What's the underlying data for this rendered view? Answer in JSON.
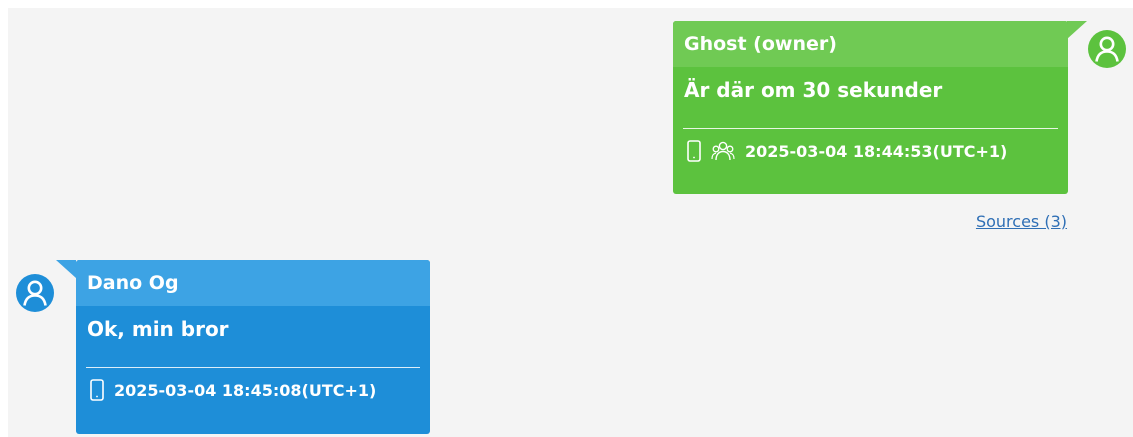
{
  "colors": {
    "background": "#f4f4f4",
    "green_bubble": "#5cc23e",
    "green_header": "#70ca54",
    "blue_bubble": "#1e8ed8",
    "blue_header": "#3da3e4",
    "link": "#2f6fb5"
  },
  "messages": [
    {
      "direction": "outgoing",
      "sender": "Ghost (owner)",
      "text": "Är där om 30 sekunder",
      "timestamp": "2025-03-04 18:44:53(UTC+1)",
      "icons": [
        "phone-icon",
        "contacts-group-icon"
      ],
      "sources_label": "Sources (3)"
    },
    {
      "direction": "incoming",
      "sender": "Dano Og",
      "text": "Ok, min bror",
      "timestamp": "2025-03-04 18:45:08(UTC+1)",
      "icons": [
        "phone-icon"
      ]
    }
  ]
}
